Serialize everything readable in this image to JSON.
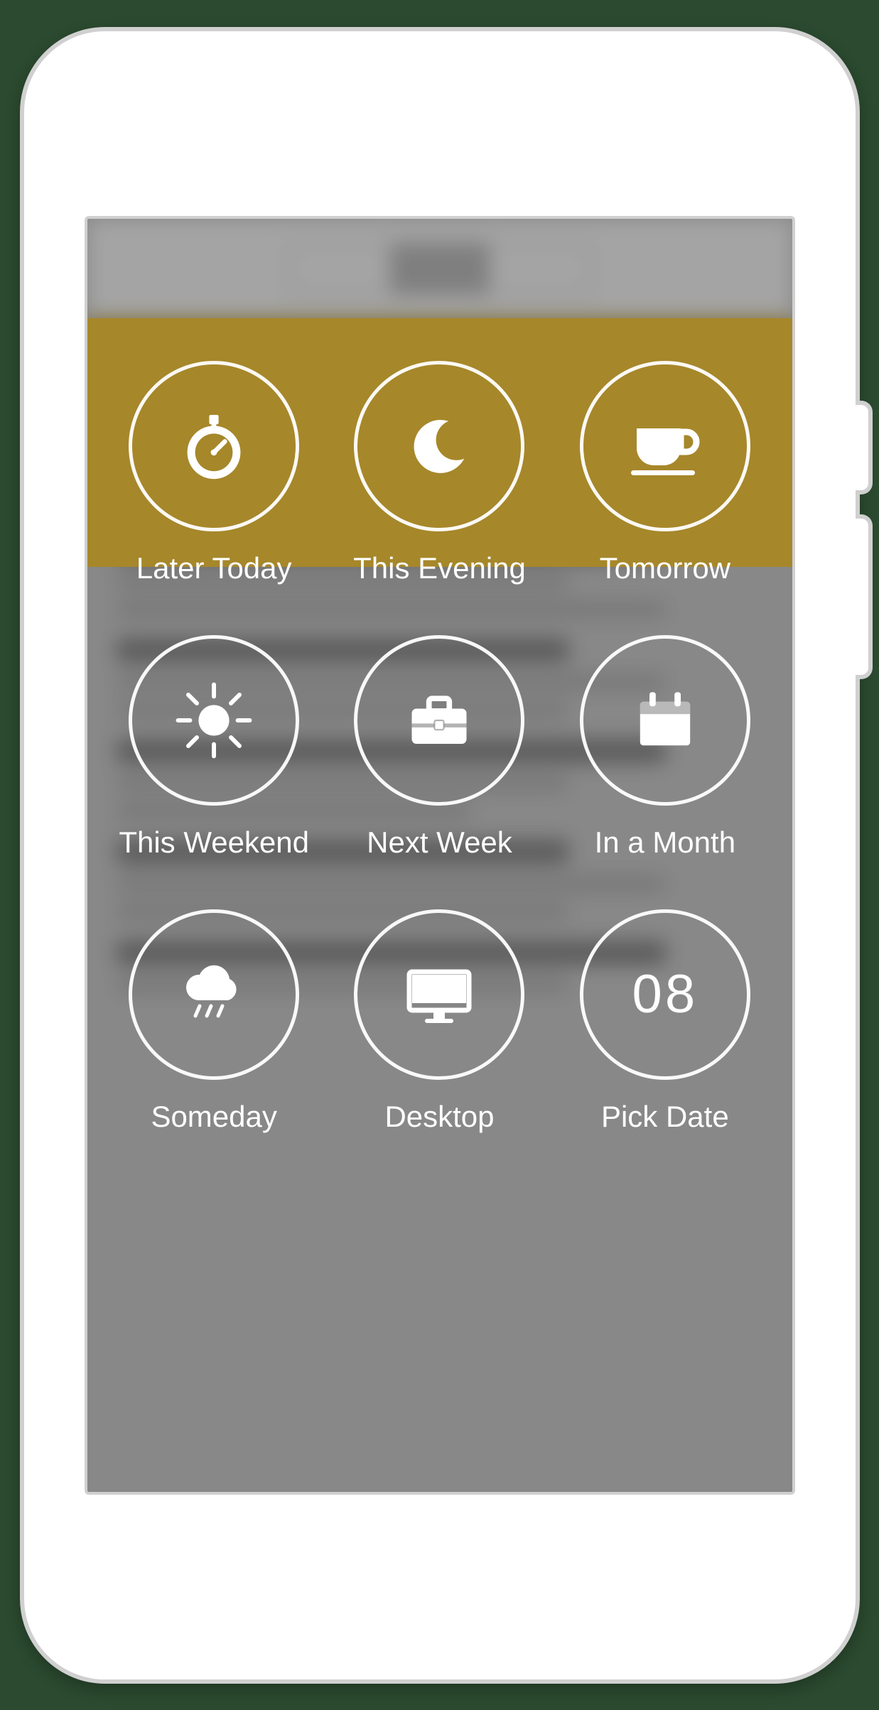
{
  "snooze_grid": {
    "items": [
      {
        "label": "Later Today",
        "icon": "stopwatch-icon"
      },
      {
        "label": "This Evening",
        "icon": "moon-icon"
      },
      {
        "label": "Tomorrow",
        "icon": "coffee-icon"
      },
      {
        "label": "This Weekend",
        "icon": "sun-icon"
      },
      {
        "label": "Next Week",
        "icon": "briefcase-icon"
      },
      {
        "label": "In a Month",
        "icon": "calendar-icon"
      },
      {
        "label": "Someday",
        "icon": "cloud-rain-icon"
      },
      {
        "label": "Desktop",
        "icon": "desktop-icon"
      },
      {
        "label": "Pick Date",
        "icon": "pick-date-icon",
        "day_number": "08"
      }
    ]
  },
  "colors": {
    "accent": "#a6872a"
  }
}
